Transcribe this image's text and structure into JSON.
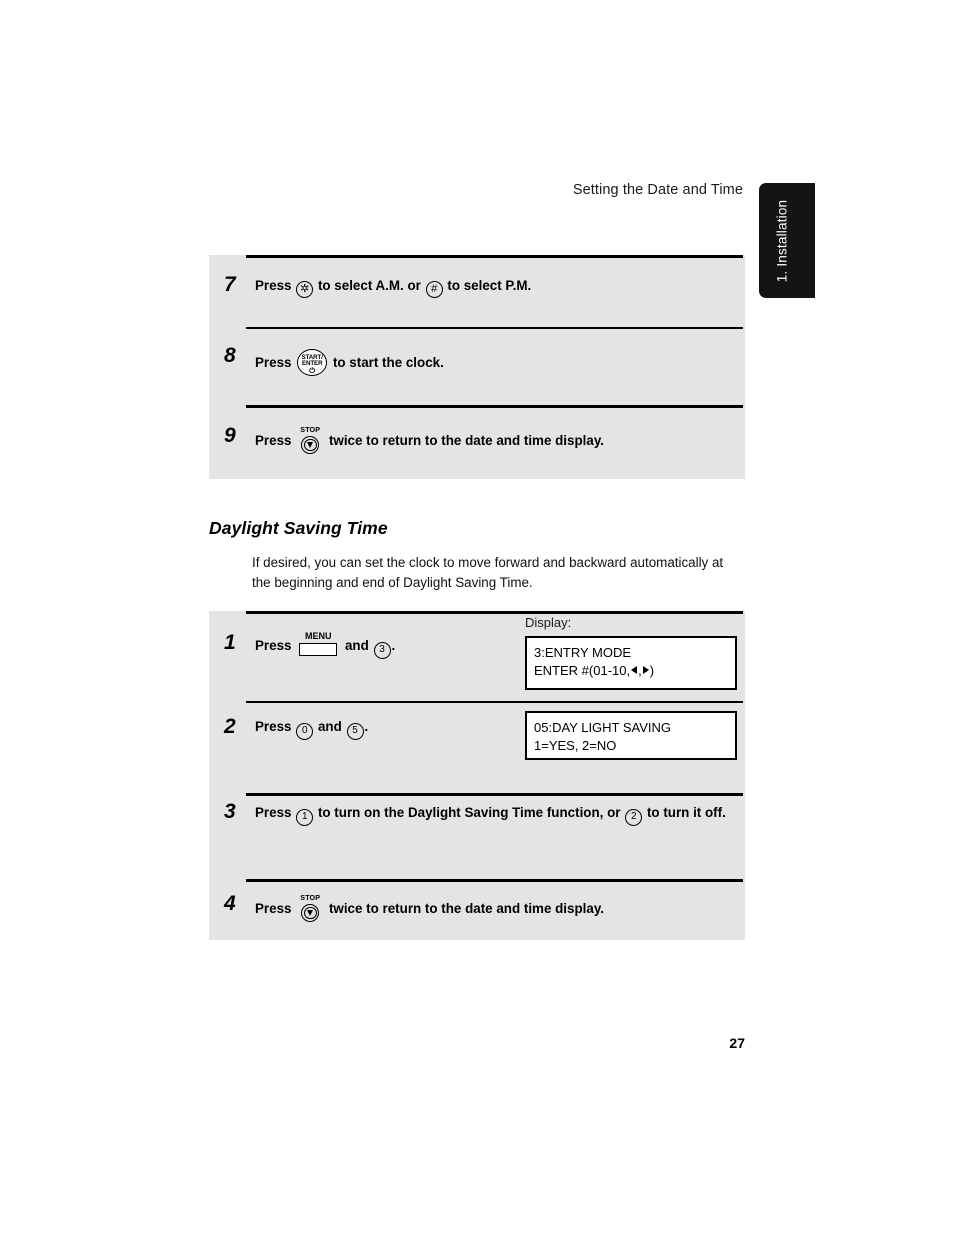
{
  "header": {
    "running_title": "Setting the Date and Time"
  },
  "side_tab": {
    "label": "1. Installation",
    "color": "#141414"
  },
  "clock_steps": [
    {
      "number": "7",
      "press_label": "Press",
      "key1": "asterisk-key",
      "key1_glyph": "✲",
      "text_mid": "to select A.M. or",
      "key2": "hash-key",
      "key2_glyph": "#",
      "text_end": "to select P.M."
    },
    {
      "number": "8",
      "press_label": "Press",
      "key_line1": "START/",
      "key_line2": "ENTER",
      "key_symbol": "⏻",
      "text_end": "to start the clock."
    },
    {
      "number": "9",
      "press_label": "Press",
      "key_caption": "STOP",
      "text_end": "twice to return to the date and time display."
    }
  ],
  "dst_section": {
    "heading": "Daylight Saving Time",
    "intro": "If desired, you can set the clock to move forward and backward automatically at the beginning and end of Daylight Saving Time.",
    "display_label": "Display:",
    "steps": [
      {
        "number": "1",
        "press_label": "Press",
        "key_menu_caption": "MENU",
        "and_label": "and",
        "key_digit": "3",
        "period": ".",
        "display_line1": "3:ENTRY MODE",
        "display_line2_a": "ENTER #(01-10,",
        "display_line2_b": ",",
        "display_line2_c": ")"
      },
      {
        "number": "2",
        "press_label": "Press",
        "key_digit1": "0",
        "and_label": "and",
        "key_digit2": "5",
        "period": ".",
        "display_line1": "05:DAY LIGHT SAVING",
        "display_line2": "1=YES, 2=NO"
      },
      {
        "number": "3",
        "press_label": "Press",
        "key_digit1": "1",
        "text_mid": "to turn on the Daylight Saving Time function, or",
        "key_digit2": "2",
        "text_end": "to turn it off."
      },
      {
        "number": "4",
        "press_label": "Press",
        "key_caption": "STOP",
        "text_end": "twice to return to the date and time display."
      }
    ]
  },
  "footer": {
    "page_number": "27"
  }
}
